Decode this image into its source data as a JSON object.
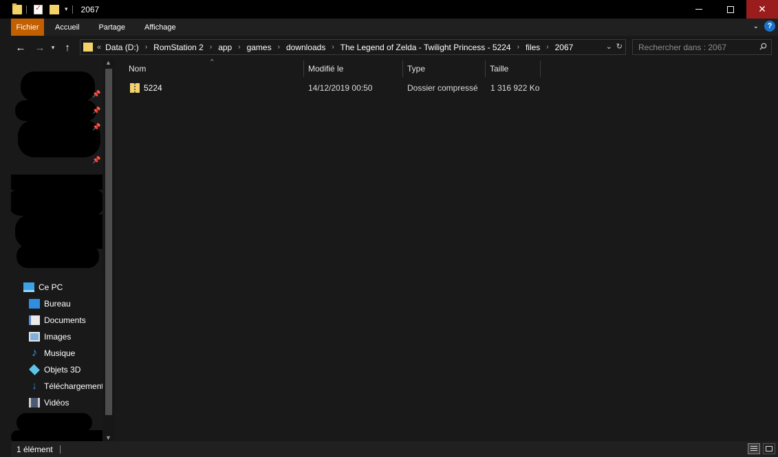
{
  "window": {
    "title": "2067"
  },
  "ribbon": {
    "tabs": [
      {
        "label": "Fichier",
        "active": true
      },
      {
        "label": "Accueil"
      },
      {
        "label": "Partage"
      },
      {
        "label": "Affichage"
      }
    ],
    "help_label": "?"
  },
  "address": {
    "more": "«",
    "breadcrumbs": [
      "Data (D:)",
      "RomStation 2",
      "app",
      "games",
      "downloads",
      "The Legend of Zelda - Twilight Princess - 5224",
      "files",
      "2067"
    ]
  },
  "search": {
    "placeholder": "Rechercher dans : 2067"
  },
  "navpane": {
    "this_pc": "Ce PC",
    "items": [
      {
        "label": "Bureau",
        "icon": "desktop-icon"
      },
      {
        "label": "Documents",
        "icon": "documents-icon"
      },
      {
        "label": "Images",
        "icon": "images-icon"
      },
      {
        "label": "Musique",
        "icon": "music-icon"
      },
      {
        "label": "Objets 3D",
        "icon": "objects-3d-icon"
      },
      {
        "label": "Téléchargements",
        "icon": "downloads-icon"
      },
      {
        "label": "Vidéos",
        "icon": "videos-icon"
      }
    ]
  },
  "columns": {
    "name": "Nom",
    "modified": "Modifié le",
    "type": "Type",
    "size": "Taille"
  },
  "files": [
    {
      "name": "5224",
      "modified": "14/12/2019 00:50",
      "type": "Dossier compressé",
      "size": "1 316 922 Ko",
      "icon": "zip-folder-icon"
    }
  ],
  "status": {
    "count": "1 élément"
  },
  "colors": {
    "accent_file_tab": "#c25f00",
    "background": "#191919",
    "title_bar": "#000000",
    "close_button": "#9b1c1c"
  }
}
